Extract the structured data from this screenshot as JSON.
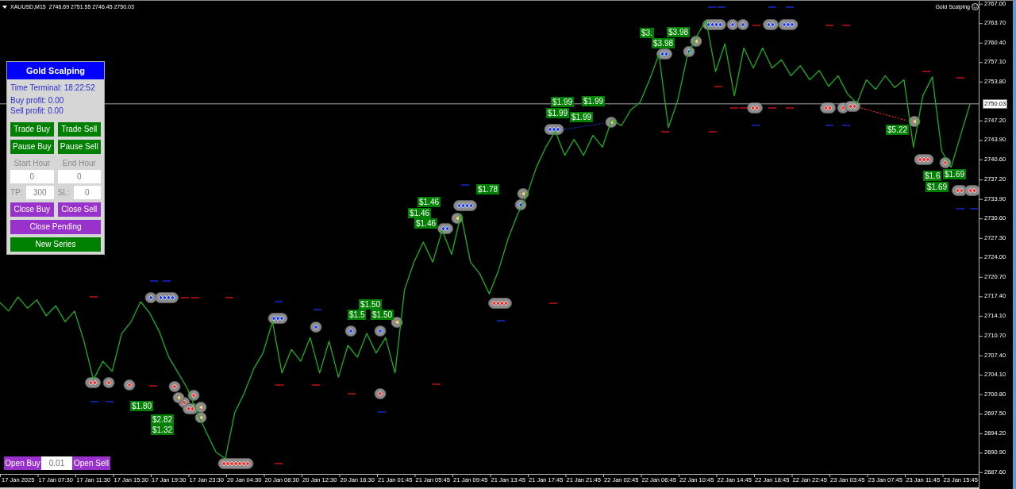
{
  "header": {
    "prices": "2746.69 2751.55 2746.45 2750.03"
  },
  "expert_label": "Gold Scalping",
  "panel": {
    "title": "Gold Scalping",
    "time": "Time Terminal: 18:22:52",
    "buy_profit": "Buy profit: 0.00",
    "sell_profit": "Sell profit: 0.00",
    "trade_buttons": [
      "Trade Buy",
      "Trade Sell"
    ],
    "pause_buttons": [
      "Pause Buy",
      "Pause Sell"
    ],
    "hour_labels": [
      "Start Hour",
      "End Hour"
    ],
    "hour_fields": [
      "0",
      "0"
    ],
    "tp": {
      "label": "TP:",
      "value": "300"
    },
    "sl": {
      "label": "SL:",
      "value": "0"
    },
    "close_buttons": [
      "Close Buy",
      "Close Sell"
    ],
    "close_pending": "Close Pending",
    "new_series": "New Series"
  },
  "order_bar": {
    "buy": "Open Buy",
    "lot": "0.01",
    "sell": "Open Sell"
  },
  "chart": {
    "profit_labels": [
      "$1.80",
      "$2.82",
      "$1.32",
      "$1.50",
      "$1.5",
      "$1.50",
      "$1.46",
      "$1.46",
      "$1.46",
      "$1.78",
      "$1.99",
      "$1.99",
      "$1.99",
      "$1.99",
      "$3.",
      "$3.98",
      "$3.98",
      "$5.22",
      "$1.6",
      "$1.69",
      "$1.69"
    ],
    "chart_data": {
      "type": "line",
      "categories": [
        null,
        null,
        "17 Jan 2025",
        null,
        null,
        null,
        "17 Jan 07:30",
        null,
        null,
        null,
        "17 Jan 11:30",
        null,
        null,
        null,
        "17 Jan 15:30",
        null,
        null,
        null,
        "17 Jan 19:30",
        null,
        null,
        null,
        "17 Jan 23:30",
        null,
        null,
        null,
        "20 Jan 04:30",
        null,
        null,
        null,
        "20 Jan 08:30",
        null,
        null,
        null,
        "20 Jan 12:30",
        null,
        null,
        null,
        "20 Jan 16:30",
        null,
        null,
        null,
        "21 Jan 01:45",
        null,
        null,
        null,
        "21 Jan 05:45",
        null,
        null,
        null,
        "21 Jan 09:45",
        null,
        null,
        null,
        "21 Jan 13:45",
        null,
        null,
        null,
        "21 Jan 17:45",
        null,
        null,
        null,
        "21 Jan 21:45",
        null,
        null,
        null,
        "22 Jan 02:45",
        null,
        null,
        null,
        "22 Jan 06:45",
        null,
        null,
        null,
        "22 Jan 10:45",
        null,
        null,
        null,
        "22 Jan 14:45",
        null,
        null,
        null,
        "22 Jan 18:45",
        null,
        null,
        null,
        "22 Jan 22:45",
        null,
        null,
        null,
        "23 Jan 03:45",
        null,
        null,
        null,
        "23 Jan 07:45",
        null,
        null,
        null,
        "23 Jan 11:45",
        null,
        null,
        null,
        "23 Jan 15:45",
        null
      ],
      "series": [
        {
          "name": "XAUUSD,M15",
          "color": "#1fae1f",
          "values": [
            2716.5,
            2714.9,
            2717.3,
            2715.4,
            2716.8,
            2714.1,
            2715.8,
            2713.1,
            2714.9,
            2709.8,
            2703.3,
            2706.4,
            2704.7,
            2711.1,
            2713.1,
            2716.5,
            2714.5,
            2711.4,
            2707.1,
            2704.4,
            2701.7,
            2697.7,
            2694.3,
            2691.0,
            2689.9,
            2697.7,
            2701.0,
            2705.1,
            2707.8,
            2713.1,
            2704.4,
            2708.4,
            2706.4,
            2710.4,
            2704.4,
            2709.8,
            2703.7,
            2709.1,
            2707.1,
            2711.1,
            2707.8,
            2710.4,
            2704.4,
            2718.5,
            2723.2,
            2726.6,
            2723.2,
            2728.6,
            2724.5,
            2731.3,
            2723.2,
            2721.2,
            2717.8,
            2721.9,
            2727.2,
            2731.3,
            2734.6,
            2739.3,
            2742.7,
            2745.4,
            2741.3,
            2744.0,
            2741.3,
            2744.7,
            2742.7,
            2747.4,
            2746.3,
            2749.0,
            2750.3,
            2754.1,
            2758.4,
            2746.0,
            2750.7,
            2758.1,
            2761.5,
            2764.2,
            2755.5,
            2760.2,
            2751.4,
            2759.5,
            2756.1,
            2759.5,
            2756.1,
            2757.5,
            2754.8,
            2756.5,
            2754.1,
            2755.7,
            2753.0,
            2754.8,
            2751.7,
            2750.1,
            2754.1,
            2752.5,
            2754.8,
            2752.8,
            2754.1,
            2742.7,
            2751.4,
            2754.6,
            2742.0,
            2739.3,
            2744.7,
            2750.0
          ]
        }
      ],
      "ref_lines": [
        {
          "axis": "y",
          "value": 2750.03,
          "label": "2750.03"
        }
      ],
      "ylim": [
        2687.3,
        2767.5
      ],
      "yticks": [
        {
          "value": 2767.0,
          "label": "2767.00"
        },
        {
          "value": 2763.7,
          "label": "2763.70"
        },
        {
          "value": 2760.4,
          "label": "2760.40"
        },
        {
          "value": 2757.1,
          "label": "2757.10"
        },
        {
          "value": 2753.8,
          "label": "2753.80"
        },
        {
          "value": 2747.2,
          "label": "2747.20"
        },
        {
          "value": 2743.9,
          "label": "2743.90"
        },
        {
          "value": 2740.6,
          "label": "2740.60"
        },
        {
          "value": 2737.2,
          "label": "2737.20"
        },
        {
          "value": 2733.9,
          "label": "2733.90"
        },
        {
          "value": 2730.6,
          "label": "2730.60"
        },
        {
          "value": 2727.3,
          "label": "2727.30"
        },
        {
          "value": 2724.0,
          "label": "2724.00"
        },
        {
          "value": 2720.7,
          "label": "2720.70"
        },
        {
          "value": 2717.4,
          "label": "2717.40"
        },
        {
          "value": 2714.1,
          "label": "2714.10"
        },
        {
          "value": 2710.7,
          "label": "2710.70"
        },
        {
          "value": 2707.4,
          "label": "2707.40"
        },
        {
          "value": 2704.1,
          "label": "2704.10"
        },
        {
          "value": 2700.8,
          "label": "2700.80"
        },
        {
          "value": 2697.5,
          "label": "2697.50"
        },
        {
          "value": 2694.2,
          "label": "2694.20"
        },
        {
          "value": 2690.9,
          "label": "2690.90"
        },
        {
          "value": 2687.6,
          "label": "2687.60"
        }
      ]
    }
  }
}
